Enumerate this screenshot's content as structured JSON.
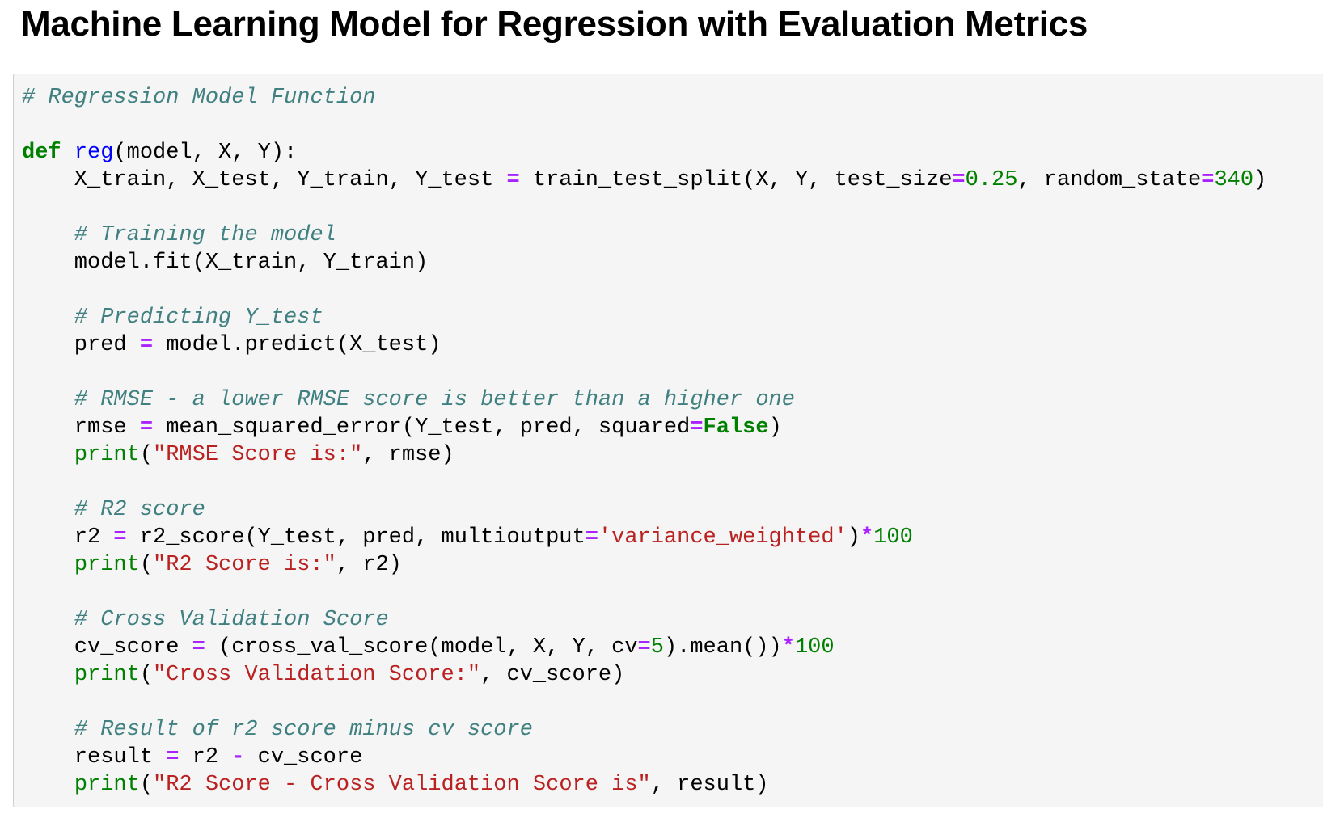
{
  "title": "Machine Learning Model for Regression with Evaluation Metrics",
  "code_cell": {
    "lines": [
      [
        {
          "t": "# Regression Model Function",
          "k": "comment"
        }
      ],
      [],
      [
        {
          "t": "def",
          "k": "kw"
        },
        {
          "t": " "
        },
        {
          "t": "reg",
          "k": "def"
        },
        {
          "t": "(model, X, Y):"
        }
      ],
      [
        {
          "t": "    X_train, X_test, Y_train, Y_test "
        },
        {
          "t": "=",
          "k": "op"
        },
        {
          "t": " train_test_split(X, Y, test_size"
        },
        {
          "t": "=",
          "k": "op"
        },
        {
          "t": "0.25",
          "k": "num"
        },
        {
          "t": ", random_state"
        },
        {
          "t": "=",
          "k": "op"
        },
        {
          "t": "340",
          "k": "num"
        },
        {
          "t": ")"
        }
      ],
      [],
      [
        {
          "t": "    "
        },
        {
          "t": "# Training the model",
          "k": "comment"
        }
      ],
      [
        {
          "t": "    model.fit(X_train, Y_train)"
        }
      ],
      [],
      [
        {
          "t": "    "
        },
        {
          "t": "# Predicting Y_test",
          "k": "comment"
        }
      ],
      [
        {
          "t": "    pred "
        },
        {
          "t": "=",
          "k": "op"
        },
        {
          "t": " model.predict(X_test)"
        }
      ],
      [],
      [
        {
          "t": "    "
        },
        {
          "t": "# RMSE - a lower RMSE score is better than a higher one",
          "k": "comment"
        }
      ],
      [
        {
          "t": "    rmse "
        },
        {
          "t": "=",
          "k": "op"
        },
        {
          "t": " mean_squared_error(Y_test, pred, squared"
        },
        {
          "t": "=",
          "k": "op"
        },
        {
          "t": "False",
          "k": "kw"
        },
        {
          "t": ")"
        }
      ],
      [
        {
          "t": "    "
        },
        {
          "t": "print",
          "k": "builtin"
        },
        {
          "t": "("
        },
        {
          "t": "\"RMSE Score is:\"",
          "k": "str"
        },
        {
          "t": ", rmse)"
        }
      ],
      [],
      [
        {
          "t": "    "
        },
        {
          "t": "# R2 score",
          "k": "comment"
        }
      ],
      [
        {
          "t": "    r2 "
        },
        {
          "t": "=",
          "k": "op"
        },
        {
          "t": " r2_score(Y_test, pred, multioutput"
        },
        {
          "t": "=",
          "k": "op"
        },
        {
          "t": "'variance_weighted'",
          "k": "str"
        },
        {
          "t": ")"
        },
        {
          "t": "*",
          "k": "op"
        },
        {
          "t": "100",
          "k": "num"
        }
      ],
      [
        {
          "t": "    "
        },
        {
          "t": "print",
          "k": "builtin"
        },
        {
          "t": "("
        },
        {
          "t": "\"R2 Score is:\"",
          "k": "str"
        },
        {
          "t": ", r2)"
        }
      ],
      [],
      [
        {
          "t": "    "
        },
        {
          "t": "# Cross Validation Score",
          "k": "comment"
        }
      ],
      [
        {
          "t": "    cv_score "
        },
        {
          "t": "=",
          "k": "op"
        },
        {
          "t": " (cross_val_score(model, X, Y, cv"
        },
        {
          "t": "=",
          "k": "op"
        },
        {
          "t": "5",
          "k": "num"
        },
        {
          "t": ").mean())"
        },
        {
          "t": "*",
          "k": "op"
        },
        {
          "t": "100",
          "k": "num"
        }
      ],
      [
        {
          "t": "    "
        },
        {
          "t": "print",
          "k": "builtin"
        },
        {
          "t": "("
        },
        {
          "t": "\"Cross Validation Score:\"",
          "k": "str"
        },
        {
          "t": ", cv_score)"
        }
      ],
      [],
      [
        {
          "t": "    "
        },
        {
          "t": "# Result of r2 score minus cv score",
          "k": "comment"
        }
      ],
      [
        {
          "t": "    result "
        },
        {
          "t": "=",
          "k": "op"
        },
        {
          "t": " r2 "
        },
        {
          "t": "-",
          "k": "op"
        },
        {
          "t": " cv_score"
        }
      ],
      [
        {
          "t": "    "
        },
        {
          "t": "print",
          "k": "builtin"
        },
        {
          "t": "("
        },
        {
          "t": "\"R2 Score - Cross Validation Score is\"",
          "k": "str"
        },
        {
          "t": ", result)"
        }
      ]
    ]
  },
  "colors": {
    "comment": "#408080",
    "keyword": "#008000",
    "function_name": "#0000ff",
    "operator": "#aa22ff",
    "number": "#008000",
    "string": "#ba2121",
    "cell_background": "#f5f5f5",
    "cell_border": "#cfcfcf"
  }
}
